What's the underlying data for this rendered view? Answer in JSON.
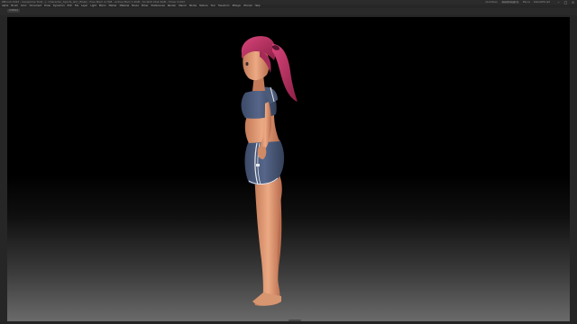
{
  "window": {
    "title": "ZBrush 2022 - Seraphine Tool[..] - Character_Sports_Girl_[final] - Free Mem 4.7GB - Active Mem 1.4GB - Scratch Disk 6GB - Timer 0.002",
    "quicksave_label": "QuickSave",
    "see_through_label": "See-through 0",
    "menus_label": "Menus",
    "default_zscript_label": "DefaultZScript"
  },
  "menus": [
    "Alpha",
    "Brush",
    "Color",
    "Document",
    "Draw",
    "Dynamics",
    "Edit",
    "File",
    "Layer",
    "Light",
    "Macro",
    "Marker",
    "Material",
    "Movie",
    "Picker",
    "Preferences",
    "Render",
    "Stencil",
    "Stroke",
    "Texture",
    "Tool",
    "Transform",
    "ZPlugin",
    "ZScript",
    "Help"
  ],
  "document_tab": "Untitled",
  "viewport": {
    "subject": "3D character model, side view",
    "background_colors": {
      "top": "#000000",
      "bottom": "#6a6a6a"
    }
  },
  "model_colors": {
    "skin": "#e8a27c",
    "skin_shade": "#b96c4e",
    "hair": "#c8386a",
    "hair_dark": "#8c1f46",
    "outfit": "#4b5a78",
    "outfit_dark": "#344058",
    "stripe": "#e6e8ee"
  },
  "icons": {
    "minimize": "minimize-icon",
    "maximize": "maximize-icon",
    "close": "close-icon"
  }
}
